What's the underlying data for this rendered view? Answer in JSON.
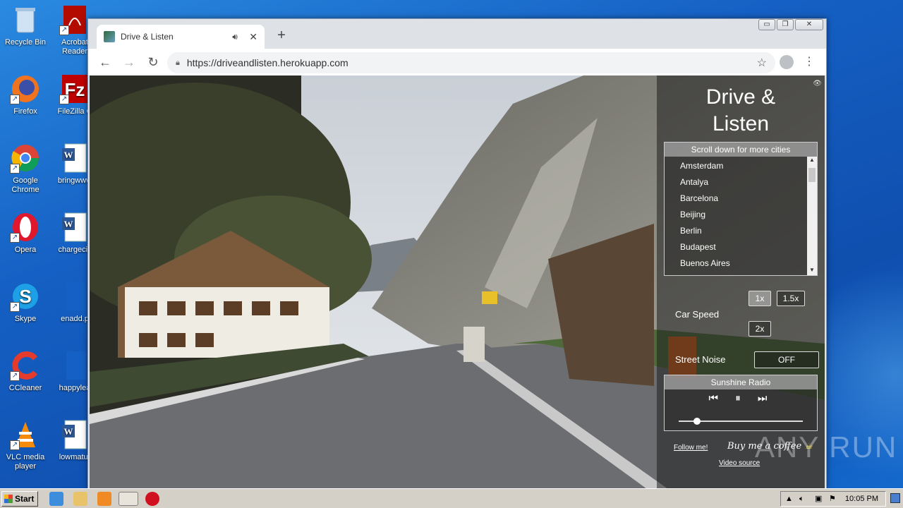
{
  "desktop": {
    "icons": [
      {
        "label": "Recycle Bin",
        "label2": ""
      },
      {
        "label": "Acrobat",
        "label2": "Reader"
      },
      {
        "label": "Firefox",
        "label2": ""
      },
      {
        "label": "FileZilla C",
        "label2": ""
      },
      {
        "label": "Google",
        "label2": "Chrome"
      },
      {
        "label": "bringwww",
        "label2": ""
      },
      {
        "label": "Opera",
        "label2": ""
      },
      {
        "label": "chargeciv",
        "label2": ""
      },
      {
        "label": "Skype",
        "label2": ""
      },
      {
        "label": "enadd.p",
        "label2": ""
      },
      {
        "label": "CCleaner",
        "label2": ""
      },
      {
        "label": "happylea",
        "label2": ""
      },
      {
        "label": "VLC media",
        "label2": "player"
      },
      {
        "label": "lowmatur",
        "label2": ""
      }
    ]
  },
  "browser": {
    "tab_title": "Drive & Listen",
    "new_tab_label": "+",
    "url": "https://driveandlisten.herokuapp.com",
    "window_controls": {
      "minimize": "▭",
      "maximize": "❐",
      "close": "✕"
    }
  },
  "app": {
    "title_line1": "Drive &",
    "title_line2": "Listen",
    "cities_header": "Scroll down for more cities",
    "cities": [
      "Amsterdam",
      "Antalya",
      "Barcelona",
      "Beijing",
      "Berlin",
      "Budapest",
      "Buenos Aires"
    ],
    "car_speed_label": "Car Speed",
    "speed_options": [
      "1x",
      "1.5x",
      "2x"
    ],
    "selected_speed": "1x",
    "street_noise_label": "Street Noise",
    "street_noise_value": "OFF",
    "radio_station": "Sunshine Radio",
    "radio_volume": 0.15,
    "follow_label": "Follow me!",
    "coffee_label": "Buy me a coffee",
    "video_source_label": "Video source"
  },
  "watermark": "ANY RUN",
  "taskbar": {
    "start_label": "Start",
    "clock": "10:05 PM"
  },
  "colors": {
    "desktop_blue": "#1560c4",
    "chrome_frame": "#dee1e6",
    "panel_overlay": "#1e1e1e"
  }
}
